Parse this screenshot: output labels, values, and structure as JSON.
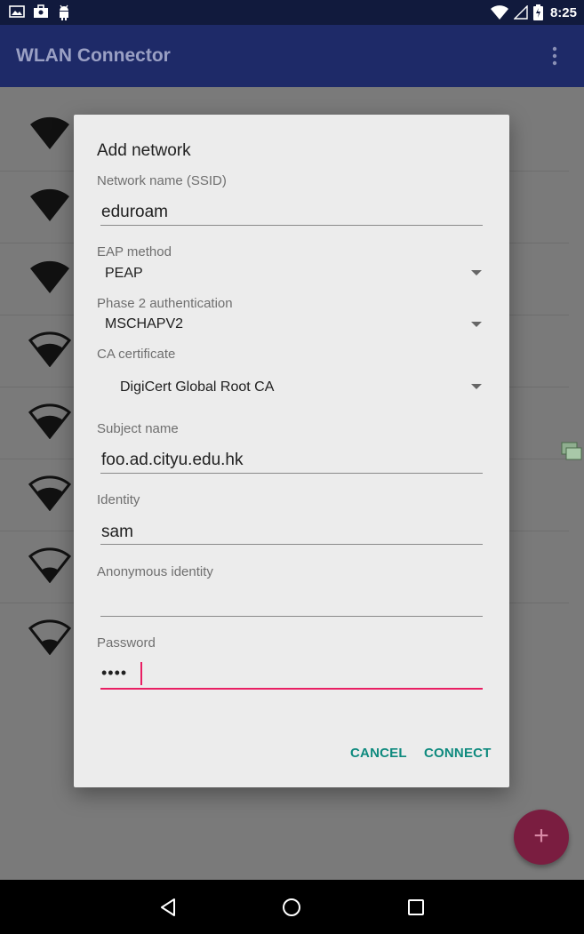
{
  "status_bar": {
    "time": "8:25",
    "left_icons": [
      "image-icon",
      "briefcase-icon",
      "android-icon"
    ],
    "right_icons": [
      "wifi-icon",
      "signal-icon",
      "battery-icon"
    ]
  },
  "app_bar": {
    "title": "WLAN Connector",
    "menu_icon": "overflow-menu-icon"
  },
  "network_list": {
    "row_count": 8
  },
  "dialog": {
    "title": "Add network",
    "ssid": {
      "label": "Network name (SSID)",
      "value": "eduroam"
    },
    "eap_method": {
      "label": "EAP method",
      "value": "PEAP"
    },
    "phase2": {
      "label": "Phase 2 authentication",
      "value": "MSCHAPV2"
    },
    "ca_certificate": {
      "label": "CA certificate",
      "value": "DigiCert Global Root CA"
    },
    "subject_name": {
      "label": "Subject name",
      "value": "foo.ad.cityu.edu.hk"
    },
    "identity": {
      "label": "Identity",
      "value": "sam"
    },
    "anonymous_identity": {
      "label": "Anonymous identity",
      "value": ""
    },
    "password": {
      "label": "Password",
      "value": "••••"
    },
    "cancel_label": "CANCEL",
    "connect_label": "CONNECT"
  },
  "fab": {
    "label": "+"
  },
  "colors": {
    "accent": "#e91e63",
    "button_text": "#0e8a7e",
    "app_bar": "#1e2a68",
    "status_bar": "#111a3d"
  }
}
